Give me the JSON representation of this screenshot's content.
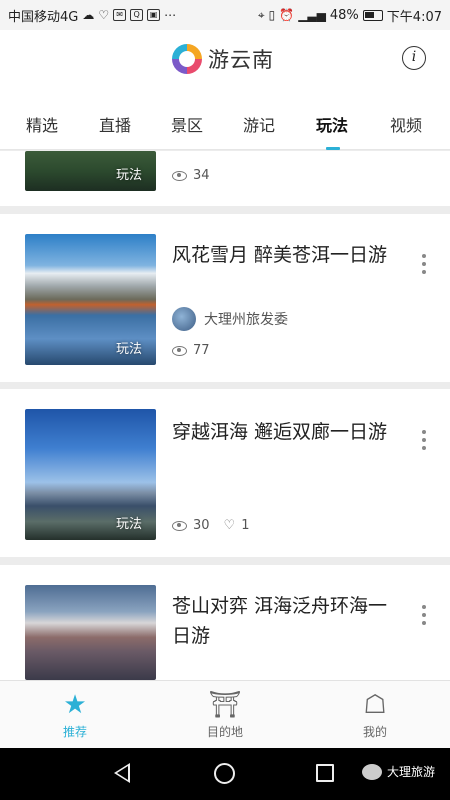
{
  "status_bar": {
    "carrier": "中国移动4G",
    "battery": "48%",
    "time": "下午4:07"
  },
  "app": {
    "logo_text": "游云南"
  },
  "tabs": [
    {
      "label": "精选"
    },
    {
      "label": "直播"
    },
    {
      "label": "景区"
    },
    {
      "label": "游记"
    },
    {
      "label": "玩法",
      "active": true
    },
    {
      "label": "视频"
    }
  ],
  "feed": [
    {
      "tag": "玩法",
      "views": "34"
    },
    {
      "title": "风花雪月 醉美苍洱一日游",
      "author": "大理州旅发委",
      "tag": "玩法",
      "views": "77"
    },
    {
      "title": "穿越洱海 邂逅双廊一日游",
      "tag": "玩法",
      "views": "30",
      "likes": "1"
    },
    {
      "title": "苍山对弈 洱海泛舟环海一日游"
    }
  ],
  "bottom_nav": [
    {
      "label": "推荐",
      "icon": "star-icon",
      "active": true
    },
    {
      "label": "目的地",
      "icon": "pavilion-icon"
    },
    {
      "label": "我的",
      "icon": "profile-icon"
    }
  ],
  "watermark": "大理旅游",
  "colors": {
    "accent": "#2bb0d6"
  }
}
